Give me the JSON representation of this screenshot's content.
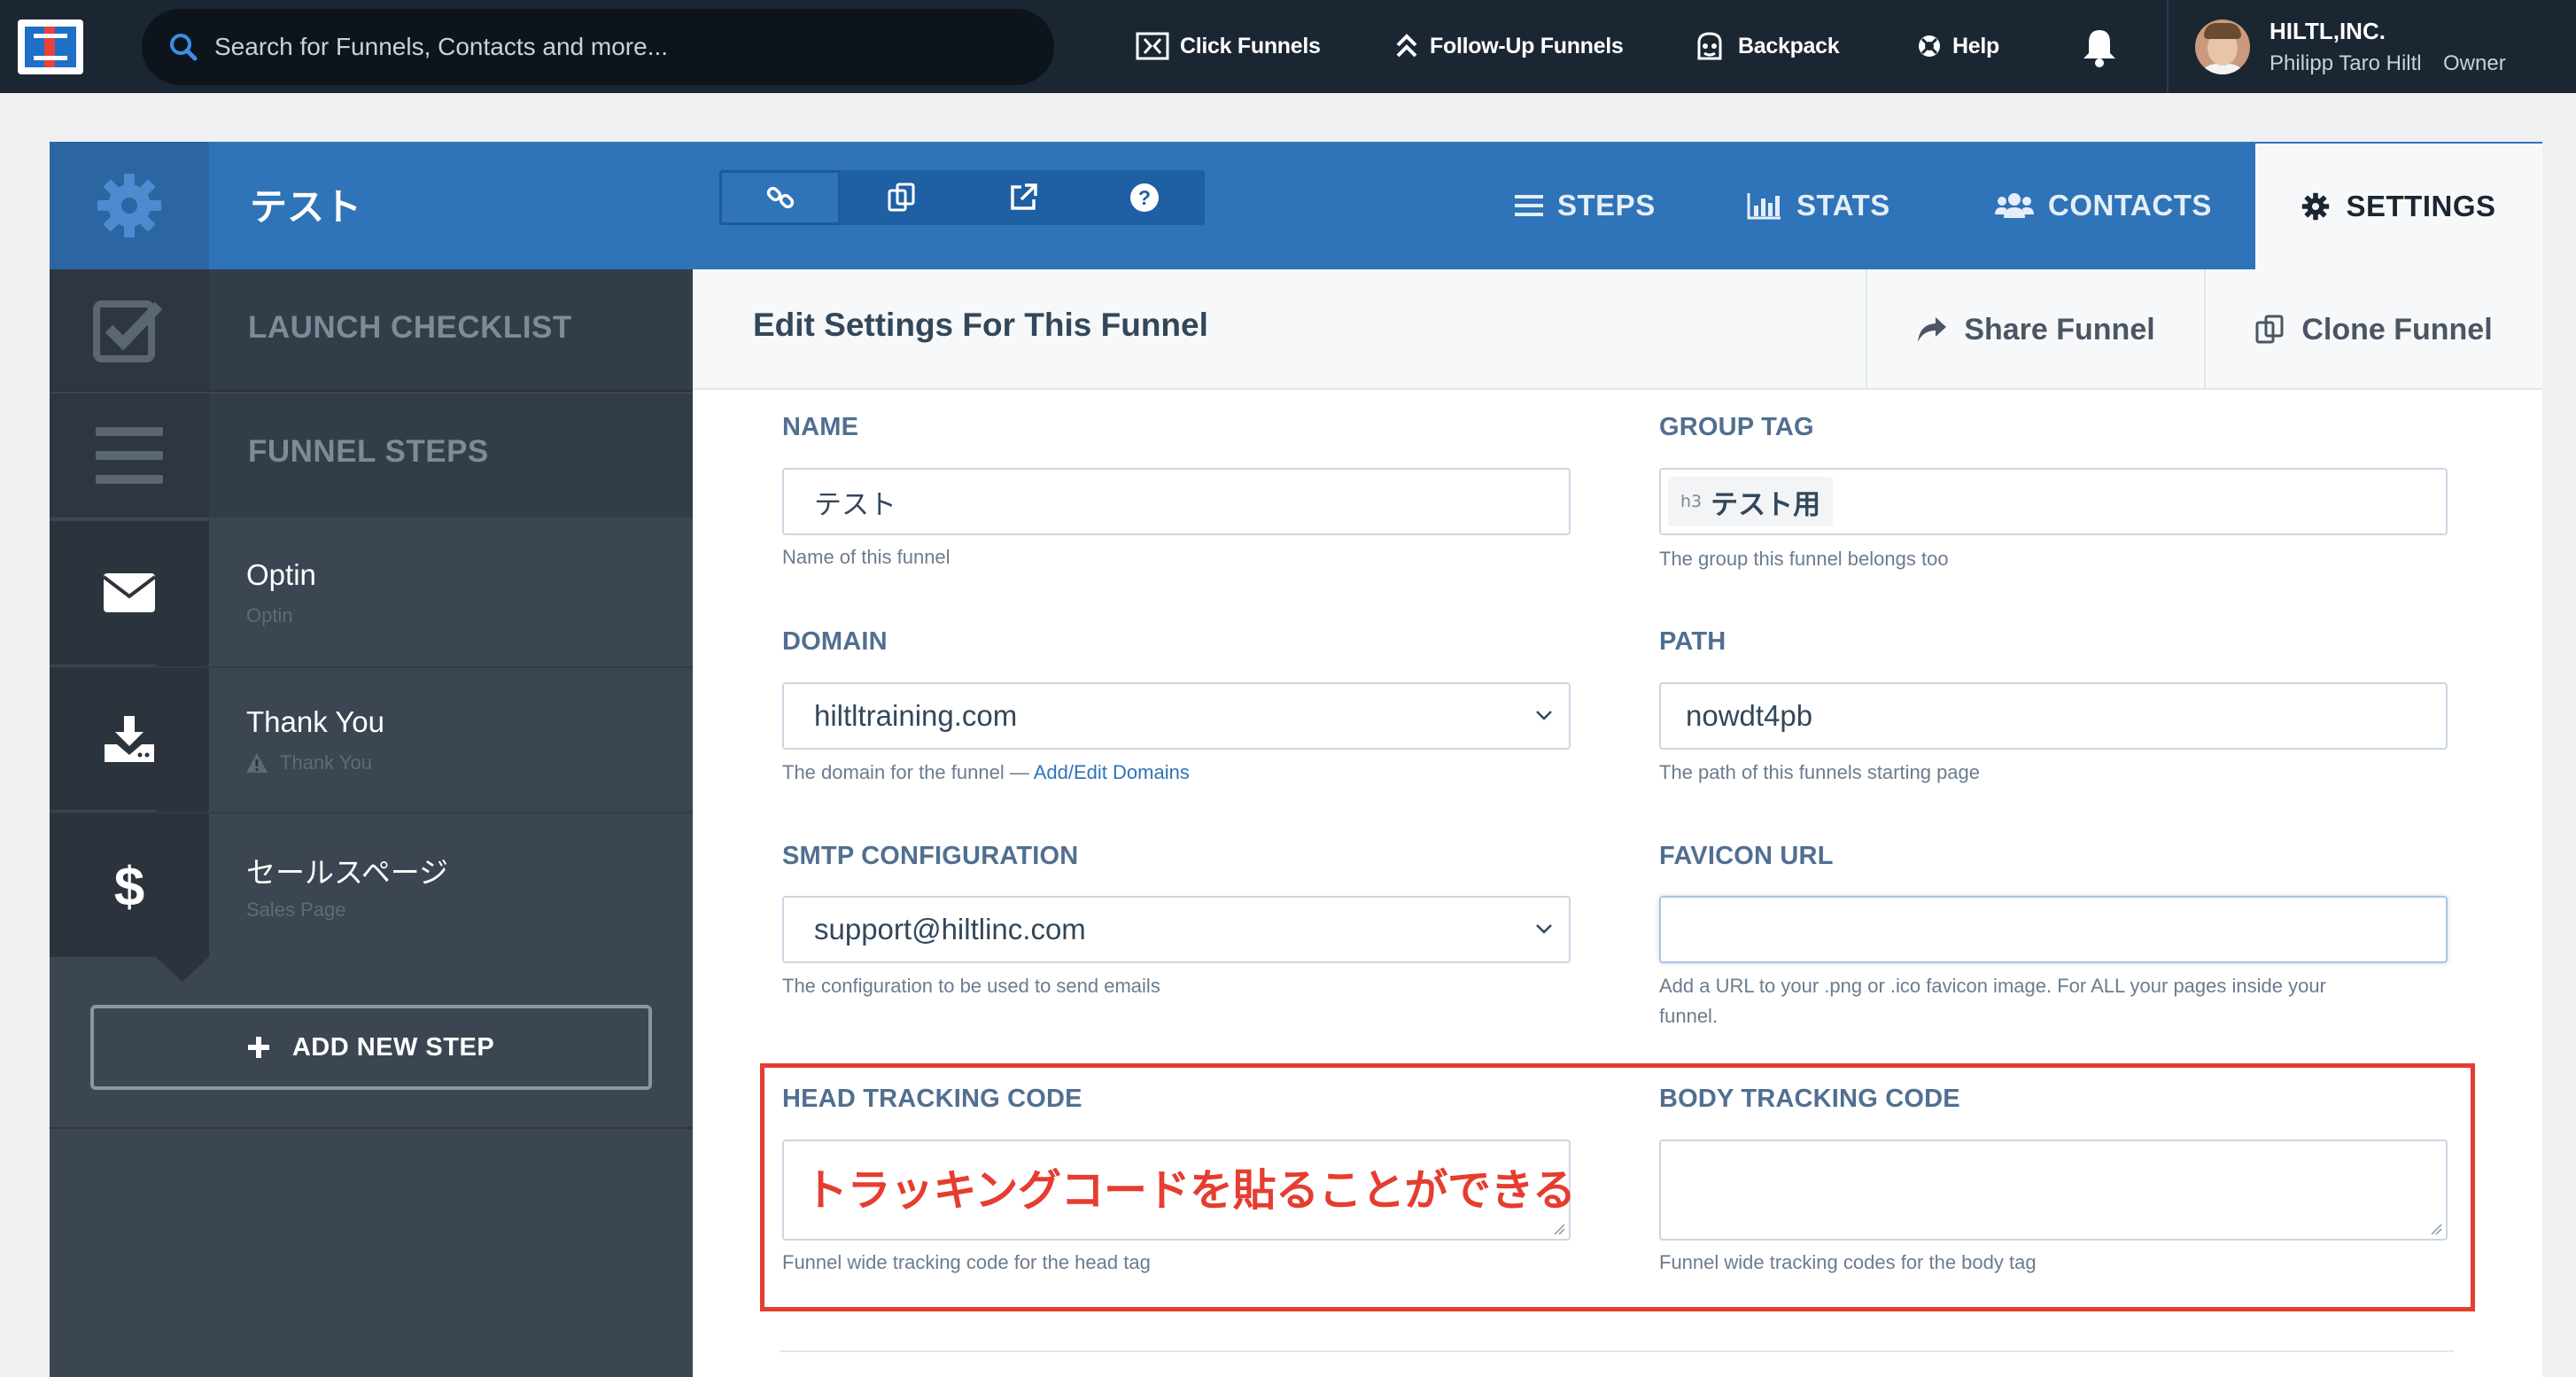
{
  "topbar": {
    "search_placeholder": "Search for Funnels, Contacts and more...",
    "nav": [
      {
        "label": "Click Funnels",
        "icon": "clickfunnels-icon"
      },
      {
        "label": "Follow-Up Funnels",
        "icon": "double-chevron-up-icon"
      },
      {
        "label": "Backpack",
        "icon": "backpack-icon"
      },
      {
        "label": "Help",
        "icon": "lifebuoy-icon"
      }
    ],
    "account": {
      "company": "HILTL,INC.",
      "user": "Philipp Taro Hiltl",
      "role": "Owner"
    }
  },
  "funnel_header": {
    "title": "テスト",
    "tools": [
      "link-icon",
      "clone-icon",
      "external-link-icon",
      "help-icon"
    ],
    "tabs": [
      {
        "label": "STEPS",
        "icon": "list-icon"
      },
      {
        "label": "STATS",
        "icon": "bar-chart-icon"
      },
      {
        "label": "CONTACTS",
        "icon": "users-icon"
      },
      {
        "label": "SETTINGS",
        "icon": "gear-icon",
        "active": true
      }
    ]
  },
  "sidebar": {
    "launch_checklist": "LAUNCH CHECKLIST",
    "funnel_steps": "FUNNEL STEPS",
    "steps": [
      {
        "name": "Optin",
        "type": "Optin",
        "icon": "envelope-icon",
        "warning": false
      },
      {
        "name": "Thank You",
        "type": "Thank You",
        "icon": "download-icon",
        "warning": true
      },
      {
        "name": "セールスページ",
        "type": "Sales Page",
        "icon": "dollar-icon",
        "warning": false
      }
    ],
    "add_step": "ADD NEW STEP"
  },
  "settings": {
    "heading": "Edit Settings For This Funnel",
    "share_label": "Share Funnel",
    "clone_label": "Clone Funnel",
    "name": {
      "label": "NAME",
      "value": "テスト",
      "help": "Name of this funnel"
    },
    "group_tag": {
      "label": "GROUP TAG",
      "tag_prefix": "h3",
      "value": "テスト用",
      "help": "The group this funnel belongs too"
    },
    "domain": {
      "label": "DOMAIN",
      "value": "hiltltraining.com",
      "help": "The domain for the funnel — ",
      "help_link": "Add/Edit Domains"
    },
    "path": {
      "label": "PATH",
      "value": "nowdt4pb",
      "help": "The path of this funnels starting page"
    },
    "smtp": {
      "label": "SMTP CONFIGURATION",
      "value": "support@hiltlinc.com",
      "help": "The configuration to be used to send emails"
    },
    "favicon": {
      "label": "FAVICON URL",
      "value": "",
      "help_line1": "Add a URL to your .png or .ico favicon image. For ALL your pages inside your",
      "help_line2": "funnel."
    },
    "head_code": {
      "label": "HEAD TRACKING CODE",
      "help": "Funnel wide tracking code for the head tag"
    },
    "body_code": {
      "label": "BODY TRACKING CODE",
      "help": "Funnel wide tracking codes for the body tag"
    }
  },
  "annotation": {
    "note": "トラッキングコードを貼ることができる",
    "color": "#e53d2f"
  },
  "colors": {
    "topbar": "#1b2633",
    "accent_blue": "#2f73b8",
    "sidebar": "#3b4652",
    "label": "#516f90"
  }
}
